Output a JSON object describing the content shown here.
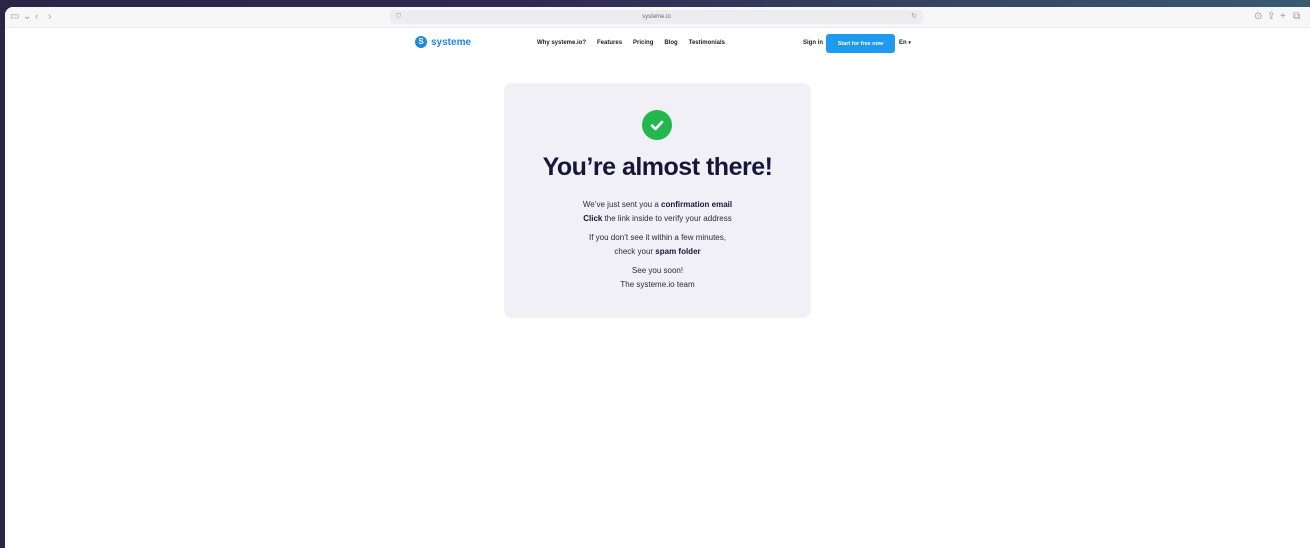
{
  "browser": {
    "url": "systeme.io"
  },
  "nav": {
    "brand": "systeme",
    "brand_letter": "S",
    "links": [
      "Why systeme.io?",
      "Features",
      "Pricing",
      "Blog",
      "Testimonials"
    ],
    "sign_in": "Sign in",
    "cta": "Start for free now",
    "language": "En"
  },
  "card": {
    "headline": "You’re almost there!",
    "line1_prefix": "We’ve just sent you a ",
    "line1_bold": "confirmation email",
    "line2_bold": "Click",
    "line2_suffix": " the link inside to verify your address",
    "line3": "If you don’t see it within a few minutes,",
    "line4_prefix": "check your ",
    "line4_bold": "spam folder",
    "line5": "See you soon!",
    "line6": "The systeme.io team"
  },
  "colors": {
    "brand": "#1e88e5",
    "cta": "#1e9bf0",
    "success": "#22b84e",
    "headline": "#17163a",
    "card_bg": "#f1f0f6"
  }
}
